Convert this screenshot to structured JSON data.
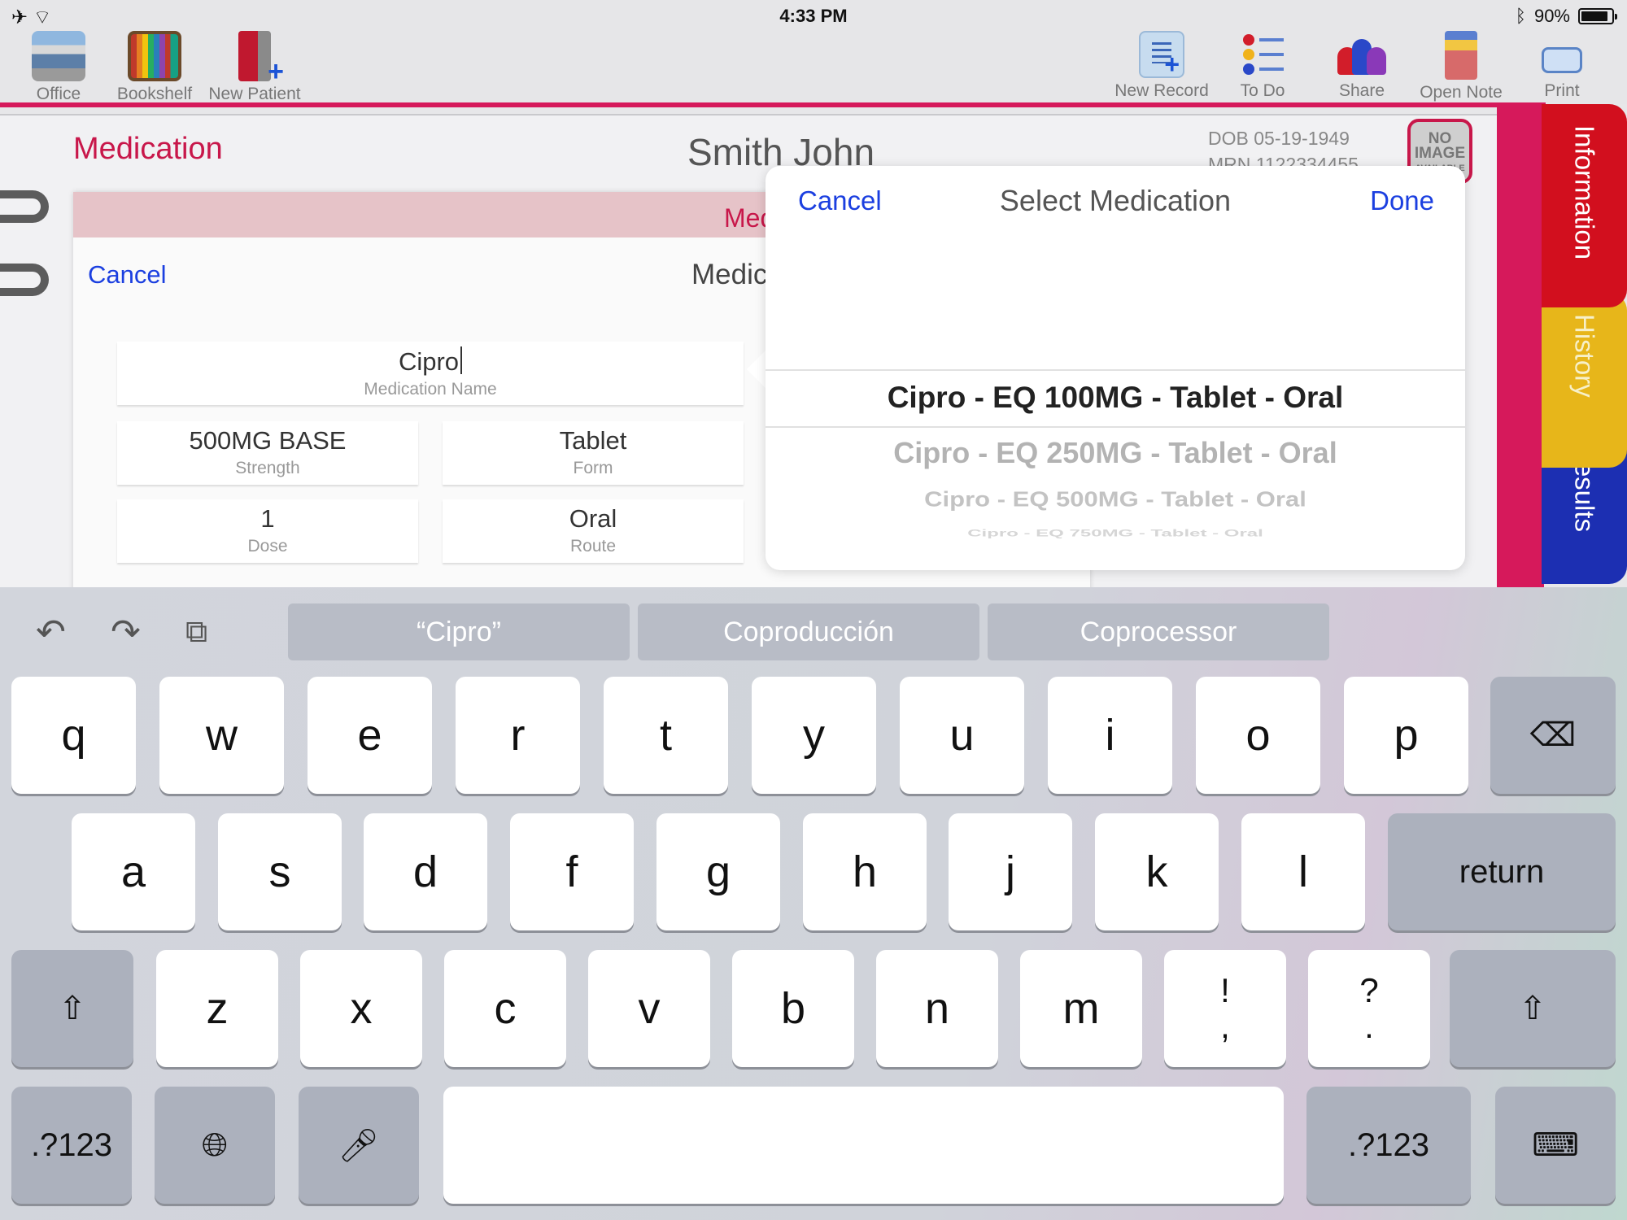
{
  "status": {
    "time": "4:33 PM",
    "battery": "90%",
    "battery_level": 0.9
  },
  "toolbar": {
    "left": [
      {
        "label": "Office",
        "icon": "office-icon"
      },
      {
        "label": "Bookshelf",
        "icon": "bookshelf-icon"
      },
      {
        "label": "New Patient",
        "icon": "new-patient-icon"
      }
    ],
    "right": [
      {
        "label": "New Record",
        "icon": "new-record-icon"
      },
      {
        "label": "To Do",
        "icon": "todo-list-icon"
      },
      {
        "label": "Share",
        "icon": "share-people-icon"
      },
      {
        "label": "Open Note",
        "icon": "open-note-icon"
      },
      {
        "label": "Print",
        "icon": "printer-icon"
      }
    ]
  },
  "page": {
    "section": "Medication",
    "patient_name": "Smith John",
    "dob": "DOB 05-19-1949",
    "mrn": "MRN 1122334455",
    "no_image": "NO IMAGE",
    "no_image_small": "AVAILABLE"
  },
  "tabs": [
    "Information",
    "History",
    "Results"
  ],
  "form": {
    "header_title": "Med",
    "cancel": "Cancel",
    "title": "Medic",
    "name": {
      "value": "Cipro",
      "label": "Medication Name"
    },
    "strength": {
      "value": "500MG BASE",
      "label": "Strength"
    },
    "form_field": {
      "value": "Tablet",
      "label": "Form"
    },
    "dose": {
      "value": "1",
      "label": "Dose"
    },
    "route": {
      "value": "Oral",
      "label": "Route"
    }
  },
  "picker": {
    "cancel": "Cancel",
    "title": "Select Medication",
    "done": "Done",
    "options": [
      "Cipro - EQ 100MG  - Tablet - Oral",
      "Cipro - EQ 250MG  - Tablet - Oral",
      "Cipro - EQ 500MG  - Tablet - Oral",
      "Cipro - EQ 750MG  - Tablet - Oral"
    ],
    "selected_index": 0
  },
  "keyboard": {
    "predictions": [
      "“Cipro”",
      "Coproducción",
      "Coprocessor"
    ],
    "row1": [
      "q",
      "w",
      "e",
      "r",
      "t",
      "y",
      "u",
      "i",
      "o",
      "p"
    ],
    "row2": [
      "a",
      "s",
      "d",
      "f",
      "g",
      "h",
      "j",
      "k",
      "l"
    ],
    "row3": [
      "z",
      "x",
      "c",
      "v",
      "b",
      "n",
      "m"
    ],
    "punct1": "!\n,",
    "punct2": "?\n.",
    "return": "return",
    "numbers": ".?123"
  }
}
